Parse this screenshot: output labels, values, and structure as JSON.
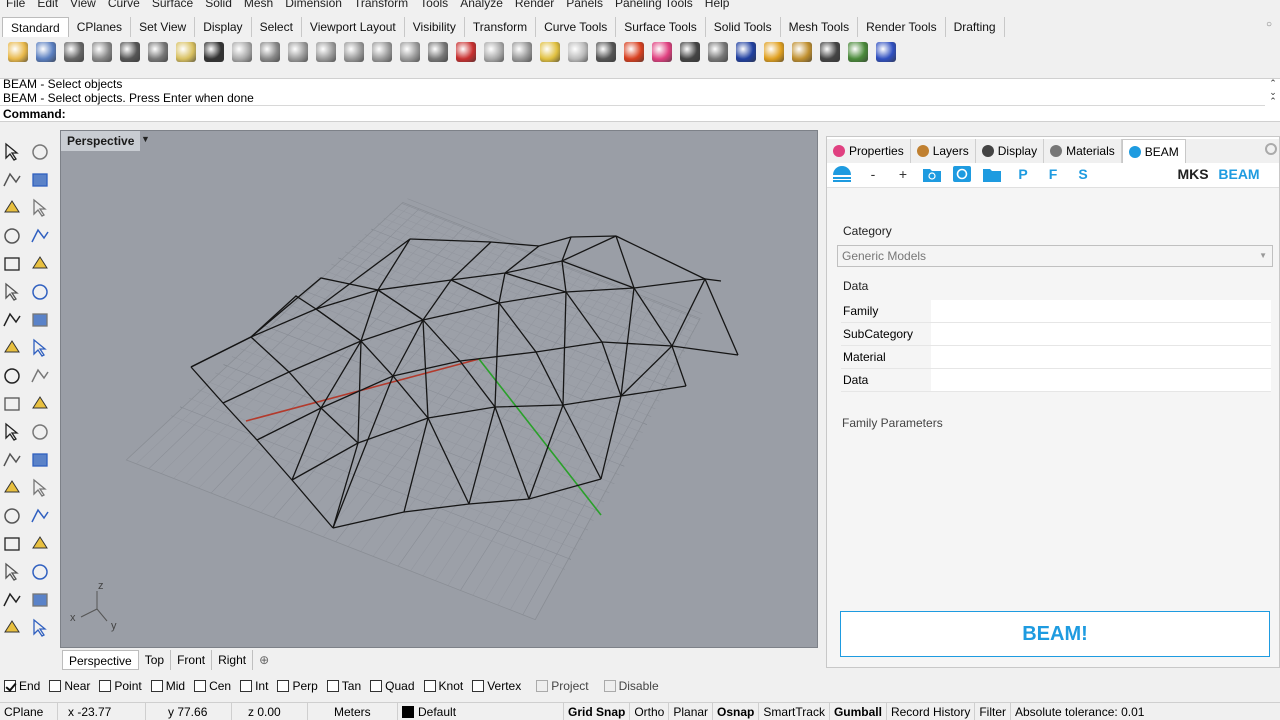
{
  "menubar": [
    "File",
    "Edit",
    "View",
    "Curve",
    "Surface",
    "Solid",
    "Mesh",
    "Dimension",
    "Transform",
    "Tools",
    "Analyze",
    "Render",
    "Panels",
    "Paneling Tools",
    "Help"
  ],
  "toolbar_tabs": [
    "Standard",
    "CPlanes",
    "Set View",
    "Display",
    "Select",
    "Viewport Layout",
    "Visibility",
    "Transform",
    "Curve Tools",
    "Surface Tools",
    "Solid Tools",
    "Mesh Tools",
    "Render Tools",
    "Drafting"
  ],
  "toolbar_icons": [
    {
      "name": "open-icon",
      "color": "#e8b84a"
    },
    {
      "name": "save-icon",
      "color": "#5a7fc0"
    },
    {
      "name": "print-icon",
      "color": "#666666"
    },
    {
      "name": "import-icon",
      "color": "#888888"
    },
    {
      "name": "cut-icon",
      "color": "#555555"
    },
    {
      "name": "copy-icon",
      "color": "#777777"
    },
    {
      "name": "paste-icon",
      "color": "#d8c060"
    },
    {
      "name": "undo-icon",
      "color": "#333333"
    },
    {
      "name": "pan-icon",
      "color": "#aaaaaa"
    },
    {
      "name": "rotate-view-icon",
      "color": "#888888"
    },
    {
      "name": "zoom-icon",
      "color": "#9a9a9a"
    },
    {
      "name": "zoom-window-icon",
      "color": "#9a9a9a"
    },
    {
      "name": "zoom-extents-icon",
      "color": "#9a9a9a"
    },
    {
      "name": "zoom-selected-icon",
      "color": "#9a9a9a"
    },
    {
      "name": "undo-view-icon",
      "color": "#9a9a9a"
    },
    {
      "name": "four-view-icon",
      "color": "#777777"
    },
    {
      "name": "car-icon",
      "color": "#c83030"
    },
    {
      "name": "car-wire-icon",
      "color": "#aaaaaa"
    },
    {
      "name": "cplane-icon",
      "color": "#999999"
    },
    {
      "name": "gumball-icon",
      "color": "#e0c040"
    },
    {
      "name": "light-icon",
      "color": "#bbbbbb"
    },
    {
      "name": "lock-icon",
      "color": "#555555"
    },
    {
      "name": "shield-icon",
      "color": "#d84020"
    },
    {
      "name": "color-wheel-icon",
      "color": "#e04080"
    },
    {
      "name": "material-sphere-icon",
      "color": "#444444"
    },
    {
      "name": "render-sphere-icon",
      "color": "#777777"
    },
    {
      "name": "blue-sphere-icon",
      "color": "#2040a0"
    },
    {
      "name": "filter-icon",
      "color": "#e0a020"
    },
    {
      "name": "options-icon",
      "color": "#c09030"
    },
    {
      "name": "dimension-icon",
      "color": "#444444"
    },
    {
      "name": "grasshopper-icon",
      "color": "#4a8a3a"
    },
    {
      "name": "help-icon",
      "color": "#3050c0"
    }
  ],
  "command": {
    "line1": "BEAM - Select objects",
    "line2": "BEAM - Select objects. Press Enter when done",
    "prompt": "Command:"
  },
  "left_tools": [
    "select-icon",
    "point-icon",
    "polyline-icon",
    "curve-icon",
    "circle-icon",
    "arc-icon",
    "ellipse-icon",
    "rectangle-icon",
    "polygon-icon",
    "fillet-icon",
    "surface-icon",
    "loft-icon",
    "box-icon",
    "sphere-icon",
    "cylinder-icon",
    "extrude-icon",
    "explode-icon",
    "trim-icon",
    "split-icon",
    "join-icon",
    "boolean-union-icon",
    "boolean-split-icon",
    "offset-icon",
    "array-icon",
    "text-icon",
    "dimension-icon",
    "move-icon",
    "rotate-icon",
    "solid-edit-icon",
    "hatch-icon",
    "grid-array-icon",
    "scale-icon",
    "analyze-icon",
    "check-icon",
    "render-icon",
    "shade-icon"
  ],
  "viewport": {
    "title": "Perspective",
    "axis_x": "x",
    "axis_y": "y",
    "axis_z": "z"
  },
  "viewport_tabs": [
    "Perspective",
    "Top",
    "Front",
    "Right"
  ],
  "panel": {
    "tabs": [
      {
        "label": "Properties",
        "color": "#e04080"
      },
      {
        "label": "Layers",
        "color": "#c08030"
      },
      {
        "label": "Display",
        "color": "#444444"
      },
      {
        "label": "Materials",
        "color": "#777777"
      },
      {
        "label": "BEAM",
        "color": "#1e9be0"
      }
    ],
    "beam_toolbar": [
      "-",
      "+",
      "P",
      "F",
      "S",
      "MKS",
      "BEAM"
    ],
    "category_label": "Category",
    "category_value": "Generic Models",
    "data_label": "Data",
    "data_rows": [
      "Family",
      "SubCategory",
      "Material",
      "Data"
    ],
    "family_params_label": "Family Parameters",
    "beam_button": "BEAM!"
  },
  "osnaps": [
    {
      "label": "End",
      "checked": true
    },
    {
      "label": "Near",
      "checked": false
    },
    {
      "label": "Point",
      "checked": false
    },
    {
      "label": "Mid",
      "checked": false
    },
    {
      "label": "Cen",
      "checked": false
    },
    {
      "label": "Int",
      "checked": false
    },
    {
      "label": "Perp",
      "checked": false
    },
    {
      "label": "Tan",
      "checked": false
    },
    {
      "label": "Quad",
      "checked": false
    },
    {
      "label": "Knot",
      "checked": false
    },
    {
      "label": "Vertex",
      "checked": false
    },
    {
      "label": "Project",
      "checked": false
    },
    {
      "label": "Disable",
      "checked": false
    }
  ],
  "status": {
    "cplane": "CPlane",
    "x": "x -23.77",
    "y": "y 77.66",
    "z": "z 0.00",
    "units": "Meters",
    "layer": "Default",
    "toggles": [
      {
        "label": "Grid Snap",
        "bold": true
      },
      {
        "label": "Ortho",
        "bold": false
      },
      {
        "label": "Planar",
        "bold": false
      },
      {
        "label": "Osnap",
        "bold": true
      },
      {
        "label": "SmartTrack",
        "bold": false
      },
      {
        "label": "Gumball",
        "bold": true
      },
      {
        "label": "Record History",
        "bold": false
      },
      {
        "label": "Filter",
        "bold": false
      }
    ],
    "tolerance": "Absolute tolerance: 0.01"
  }
}
